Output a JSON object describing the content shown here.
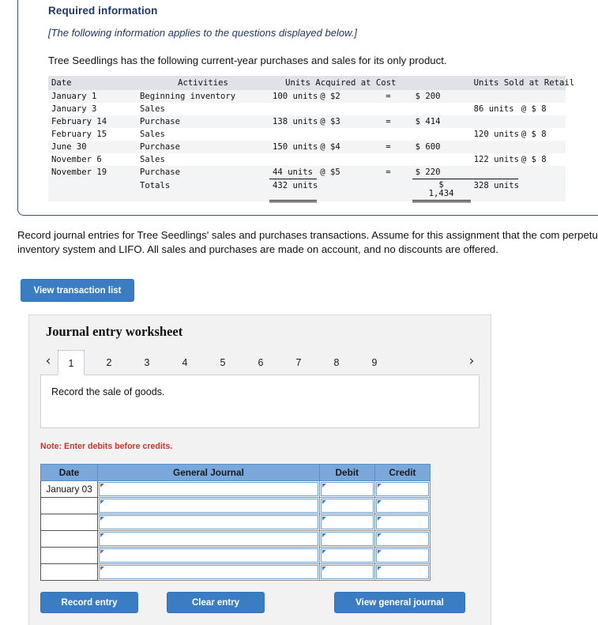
{
  "required_info": {
    "heading": "Required information",
    "italic_note": "[The following information applies to the questions displayed below.]",
    "lead": "Tree Seedlings has the following current-year purchases and sales for its only product."
  },
  "inventory_table": {
    "headers": {
      "date": "Date",
      "activities": "Activities",
      "units_acquired": "Units Acquired at Cost",
      "units_sold": "Units Sold at Retail"
    },
    "rows": [
      {
        "date": "January 1",
        "activity": "Beginning inventory",
        "units_acq": "100 units",
        "rate": "@ $2",
        "eq": "=",
        "cost": "$ 200",
        "units_sold": "",
        "retail": ""
      },
      {
        "date": "January 3",
        "activity": "Sales",
        "units_acq": "",
        "rate": "",
        "eq": "",
        "cost": "",
        "units_sold": "86 units",
        "retail": "@ $ 8"
      },
      {
        "date": "February 14",
        "activity": "Purchase",
        "units_acq": "138 units",
        "rate": "@ $3",
        "eq": "=",
        "cost": "$ 414",
        "units_sold": "",
        "retail": ""
      },
      {
        "date": "February 15",
        "activity": "Sales",
        "units_acq": "",
        "rate": "",
        "eq": "",
        "cost": "",
        "units_sold": "120 units",
        "retail": "@ $ 8"
      },
      {
        "date": "June 30",
        "activity": "Purchase",
        "units_acq": "150 units",
        "rate": "@ $4",
        "eq": "=",
        "cost": "$ 600",
        "units_sold": "",
        "retail": ""
      },
      {
        "date": "November 6",
        "activity": "Sales",
        "units_acq": "",
        "rate": "",
        "eq": "",
        "cost": "",
        "units_sold": "122 units",
        "retail": "@ $ 8"
      },
      {
        "date": "November 19",
        "activity": "Purchase",
        "units_acq": "44 units",
        "rate": "@ $5",
        "eq": "=",
        "cost": "$ 220",
        "units_sold": "",
        "retail": ""
      }
    ],
    "totals": {
      "label": "Totals",
      "units_acquired": "432 units",
      "cost_symbol": "$",
      "cost_amount": "1,434",
      "units_sold": "328 units"
    }
  },
  "instruction": "Record journal entries for Tree Seedlings' sales and purchases transactions. Assume for this assignment that the com perpetual inventory system and LIFO. All sales and purchases are made on account, and no discounts are offered.",
  "view_transaction_list_label": "View transaction list",
  "worksheet": {
    "title": "Journal entry worksheet",
    "prev_arrow": "‹",
    "next_arrow": "›",
    "tabs": [
      "1",
      "2",
      "3",
      "4",
      "5",
      "6",
      "7",
      "8",
      "9"
    ],
    "active_tab": "1",
    "description": "Record the sale of goods.",
    "note": "Note: Enter debits before credits.",
    "table": {
      "headers": [
        "Date",
        "General Journal",
        "Debit",
        "Credit"
      ],
      "rows": [
        {
          "date": "January 03",
          "general_journal": "",
          "debit": "",
          "credit": ""
        },
        {
          "date": "",
          "general_journal": "",
          "debit": "",
          "credit": ""
        },
        {
          "date": "",
          "general_journal": "",
          "debit": "",
          "credit": ""
        },
        {
          "date": "",
          "general_journal": "",
          "debit": "",
          "credit": ""
        },
        {
          "date": "",
          "general_journal": "",
          "debit": "",
          "credit": ""
        },
        {
          "date": "",
          "general_journal": "",
          "debit": "",
          "credit": ""
        }
      ]
    },
    "buttons": {
      "record_entry": "Record entry",
      "clear_entry": "Clear entry",
      "view_general_journal": "View general journal"
    }
  },
  "colors": {
    "accent_blue": "#3b7dc3",
    "header_blue": "#7aa8da",
    "title_navy": "#1f3864",
    "note_red": "#c0392b",
    "table_header_gray": "#dfe3e8"
  }
}
